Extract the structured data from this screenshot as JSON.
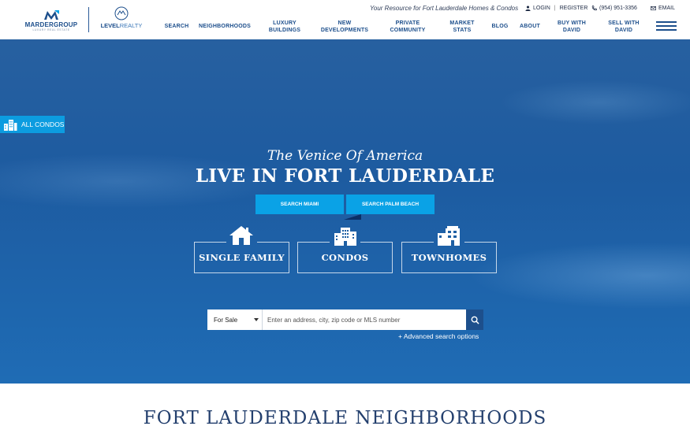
{
  "header": {
    "logos": {
      "marder_text": "MARDERGROUP",
      "marder_sub": "LUXURY REAL ESTATE",
      "level_bold": "LEVEL",
      "level_light": "REALTY"
    },
    "tagline": "Your Resource for Fort Lauderdale Homes & Condos",
    "utility": {
      "login": "LOGIN",
      "register": "REGISTER",
      "phone": "(954) 951-3356",
      "email": "EMAIL"
    },
    "nav": [
      "SEARCH",
      "NEIGHBORHOODS",
      "LUXURY BUILDINGS",
      "NEW DEVELOPMENTS",
      "PRIVATE COMMUNITY",
      "MARKET STATS",
      "BLOG",
      "ABOUT",
      "BUY WITH DAVID",
      "SELL WITH DAVID"
    ]
  },
  "hero": {
    "all_condos": "ALL CONDOS",
    "subtitle": "The Venice Of America",
    "title": "LIVE IN FORT LAUDERDALE",
    "buttons": {
      "miami": "SEARCH MIAMI",
      "palm_beach": "SEARCH PALM BEACH"
    },
    "property_types": {
      "single_family": "SINGLE FAMILY",
      "condos": "CONDOS",
      "townhomes": "TOWNHOMES"
    },
    "search": {
      "select_value": "For Sale",
      "placeholder": "Enter an address, city, zip code or MLS number",
      "advanced": "+ Advanced search options"
    }
  },
  "section": {
    "title": "FORT LAUDERDALE NEIGHBORHOODS"
  },
  "colors": {
    "brand_navy": "#1d4f8c",
    "accent_blue": "#0aa2e6",
    "hero_blue": "#1f5fa4"
  }
}
